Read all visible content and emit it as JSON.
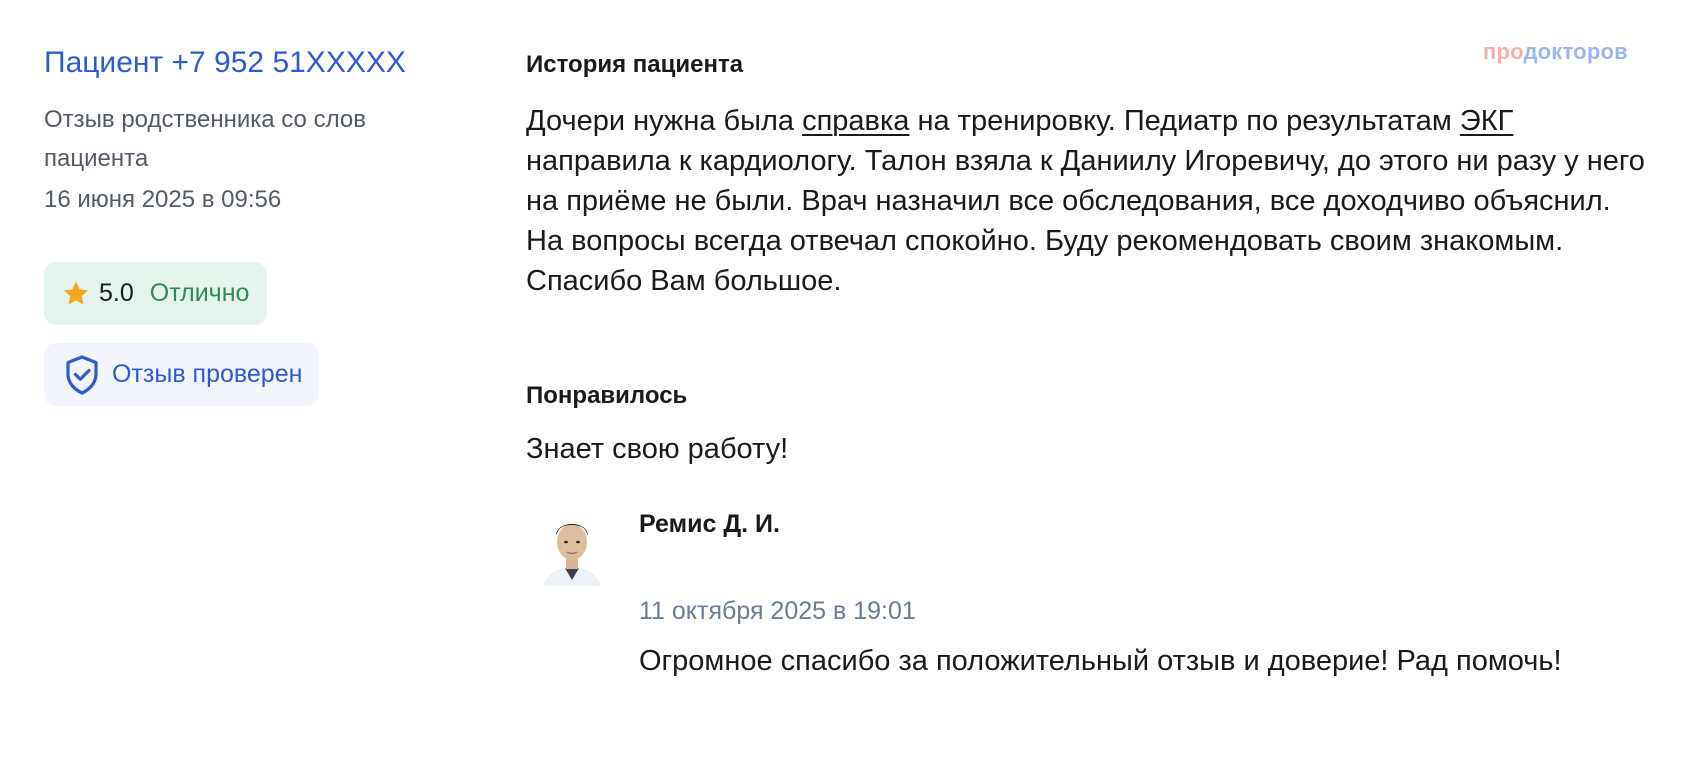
{
  "brand": {
    "part1": "про",
    "part2": "докторов"
  },
  "review": {
    "patient_name": "Пациент +7 952 51XXXXX",
    "type": "Отзыв родственника со слов пациента",
    "date": "16 июня 2025 в 09:56",
    "rating": {
      "value": "5.0",
      "label": "Отлично",
      "icon": "star-icon"
    },
    "verified": {
      "label": "Отзыв проверен",
      "icon": "shield-check-icon"
    },
    "history": {
      "title": "История пациента",
      "text_parts": [
        "Дочери нужна была ",
        "справка",
        " на тренировку. Педиатр по результатам ",
        "ЭКГ",
        " направила к кардиологу. Талон взяла к Даниилу Игоревичу, до этого ни разу у него на приёме не были. Врач назначил все обследования, все доходчиво объяснил. На вопросы всегда отвечал спокойно. Буду рекомендовать своим знакомым. Спасибо Вам большое."
      ]
    },
    "liked": {
      "title": "Понравилось",
      "text": "Знает свою работу!"
    }
  },
  "reply": {
    "doctor_name": "Ремис Д. И.",
    "date": "11 октября 2025 в 19:01",
    "text": "Огромное спасибо за положительный отзыв и доверие! Рад помочь!"
  },
  "colors": {
    "link_blue": "#2f5bd0",
    "rating_green": "#2e8a52",
    "rating_bg": "#e4f4ec",
    "verified_bg": "#f2f5fb",
    "star": "#f5a623",
    "muted_text": "#555b66",
    "reply_date": "#6b7c93"
  }
}
